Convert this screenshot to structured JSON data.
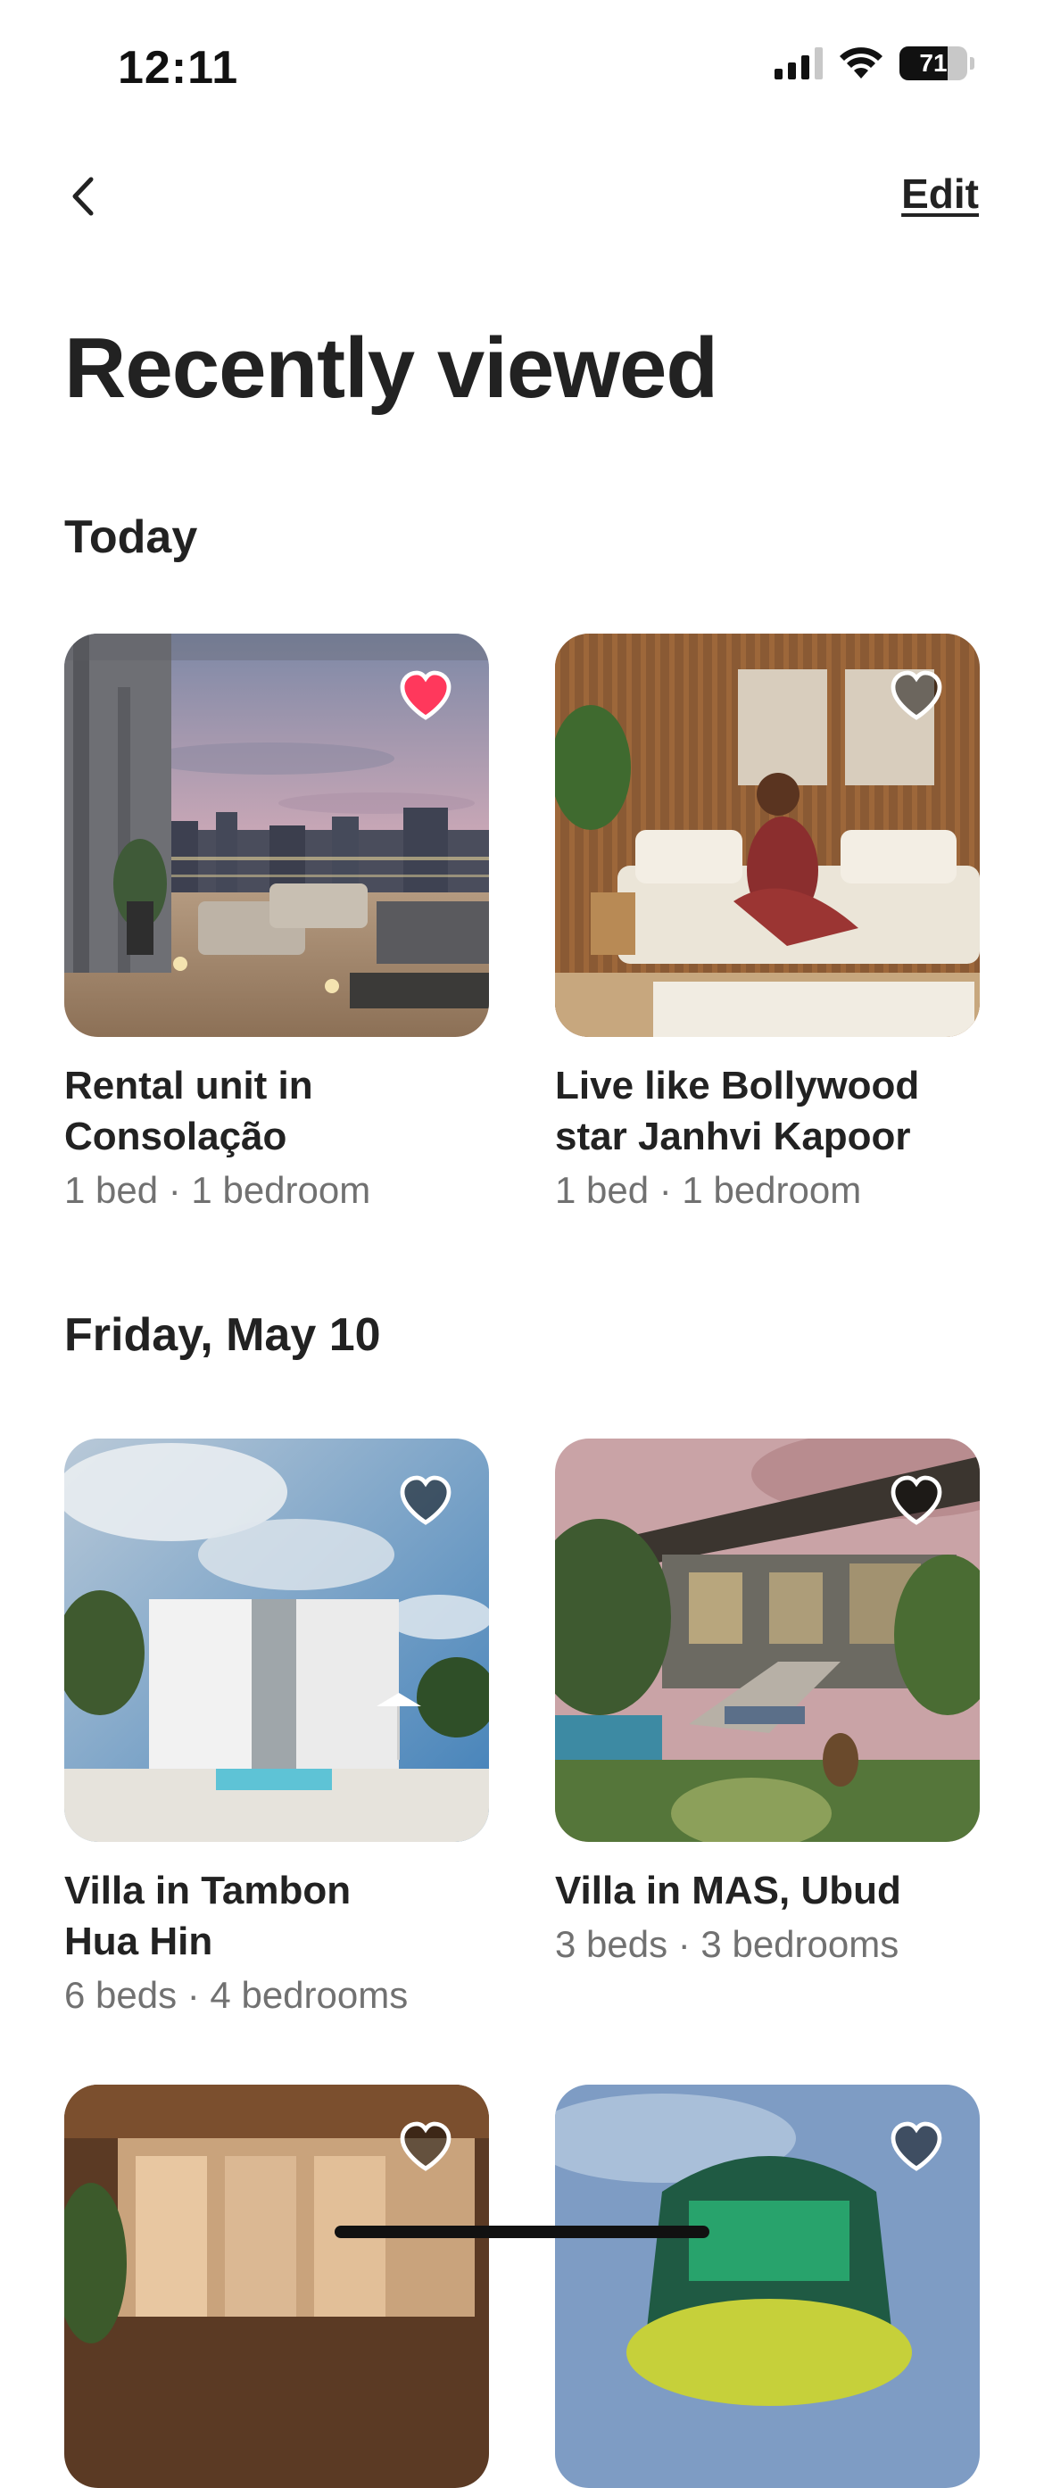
{
  "status_bar": {
    "time": "12:11",
    "battery_level": "71",
    "icons": [
      "cellular-signal-icon",
      "wifi-icon",
      "battery-icon"
    ]
  },
  "nav": {
    "back_icon": "chevron-left-icon",
    "edit_label": "Edit"
  },
  "page": {
    "title": "Recently viewed"
  },
  "sections": [
    {
      "heading": "Today",
      "listings": [
        {
          "title_line1": "Rental unit in",
          "title_line2": "Consolação",
          "details": "1 bed · 1 bedroom",
          "favorited": true
        },
        {
          "title_line1": "Live like Bollywood",
          "title_line2": "star Janhvi Kapoor",
          "details": "1 bed · 1 bedroom",
          "favorited": false
        }
      ]
    },
    {
      "heading": "Friday, May 10",
      "listings": [
        {
          "title_line1": "Villa in Tambon",
          "title_line2": "Hua Hin",
          "details": "6 beds · 4 bedrooms",
          "favorited": false
        },
        {
          "title_line1": "Villa in MAS, Ubud",
          "title_line2": "",
          "details": "3 beds · 3 bedrooms",
          "favorited": false
        },
        {
          "favorited": false
        },
        {
          "favorited": false
        }
      ]
    }
  ],
  "colors": {
    "favorite_heart": "#ff385c",
    "heart_unfilled": "rgba(0,0,0,0.5)",
    "text_primary": "#222222",
    "text_secondary": "#717171"
  }
}
